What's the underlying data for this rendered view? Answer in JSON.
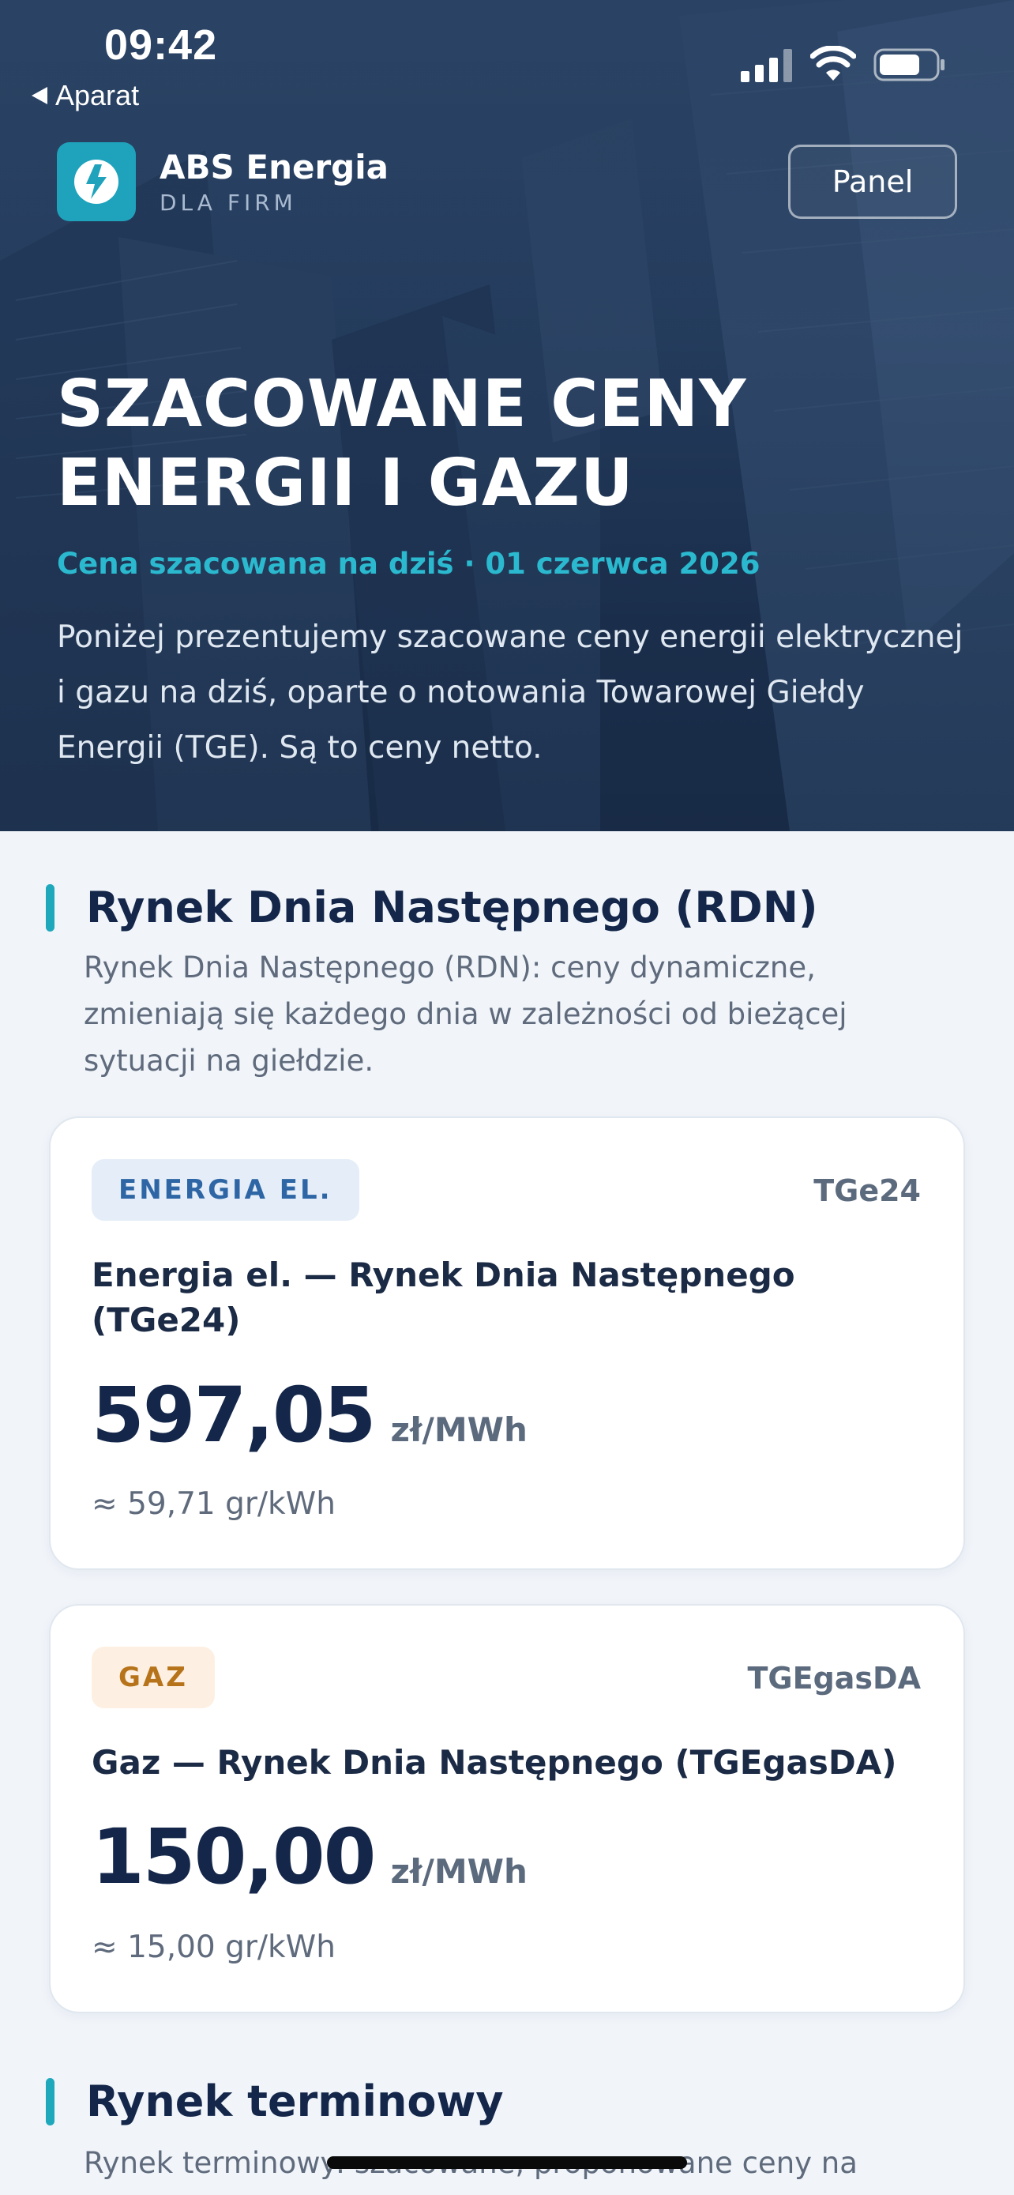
{
  "status_bar": {
    "time": "09:42",
    "back_app": "Aparat"
  },
  "header": {
    "brand_name": "ABS Energia",
    "brand_sub": "DLA FIRM",
    "logo_icon": "lightning-icon",
    "panel_label": "Panel"
  },
  "hero": {
    "title": "SZACOWANE CENY ENERGII I GAZU",
    "date_line": "Cena szacowana na dziś · 01 czerwca 2026",
    "description": "Poniżej prezentujemy szacowane ceny energii elektrycznej i gazu na dziś, oparte o notowania Towarowej Giełdy Energii (TGE). Są to ceny netto."
  },
  "sections": [
    {
      "title": "Rynek Dnia Następnego (RDN)",
      "description": "Rynek Dnia Następnego (RDN): ceny dynamiczne, zmieniają się każdego dnia w zależności od bieżącej sytuacji na giełdzie.",
      "cards": [
        {
          "tag": "ENERGIA EL.",
          "code": "TGe24",
          "title": "Energia el. — Rynek Dnia Następnego (TGe24)",
          "price": "597,05",
          "unit": "zł/MWh",
          "approx": "≈ 59,71 gr/kWh"
        },
        {
          "tag": "GAZ",
          "code": "TGEgasDA",
          "title": "Gaz — Rynek Dnia Następnego (TGEgasDA)",
          "price": "150,00",
          "unit": "zł/MWh",
          "approx": "≈ 15,00 gr/kWh"
        }
      ]
    },
    {
      "title": "Rynek terminowy",
      "description": "Rynek terminowy: szacowane, proponowane ceny na"
    }
  ],
  "colors": {
    "accent": "#1fa8bc",
    "navy": "#14274a",
    "energy_tag": "#2e66a5",
    "gas_tag": "#b7731a"
  }
}
